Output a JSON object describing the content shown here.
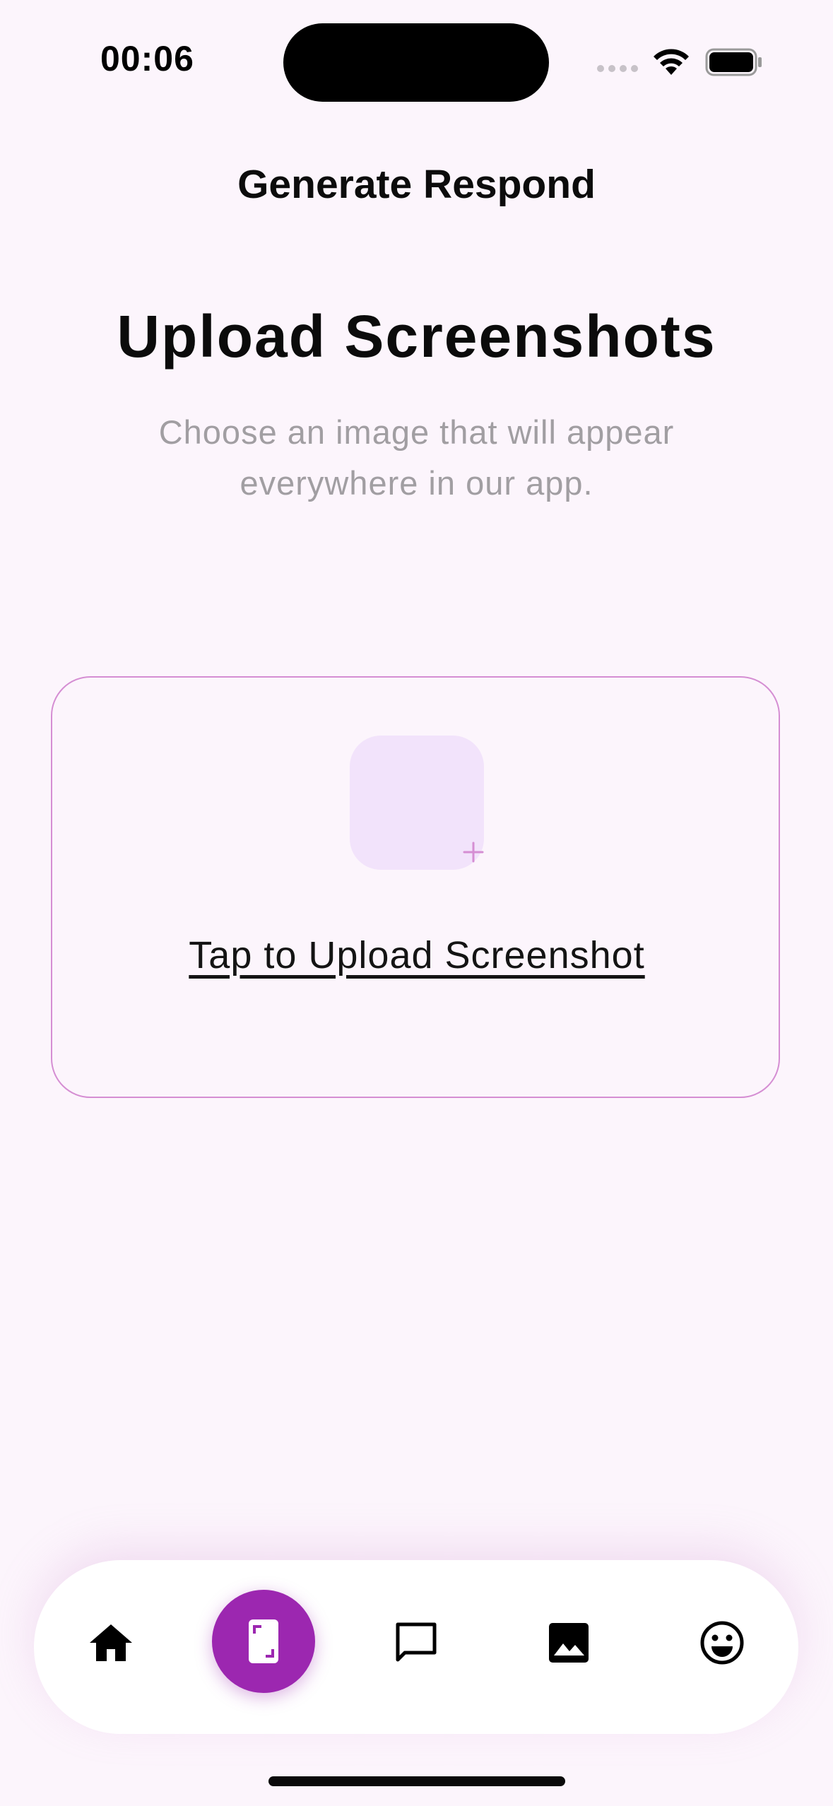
{
  "status_bar": {
    "time": "00:06"
  },
  "header": {
    "title": "Generate Respond"
  },
  "main": {
    "title": "Upload Screenshots",
    "subtitle": "Choose an image that will appear everywhere in our app.",
    "upload": {
      "label": "Tap to Upload Screenshot"
    }
  },
  "nav": {
    "items": [
      {
        "icon": "home-icon",
        "active": false
      },
      {
        "icon": "screenshot-icon",
        "active": true
      },
      {
        "icon": "chat-icon",
        "active": false
      },
      {
        "icon": "image-icon",
        "active": false
      },
      {
        "icon": "emoji-icon",
        "active": false
      }
    ]
  },
  "colors": {
    "background": "#fcf5fc",
    "accent": "#9c27b0",
    "card_border": "#d58ed3",
    "upload_tile": "#f2e3fb",
    "subtitle": "#a19ea2"
  }
}
